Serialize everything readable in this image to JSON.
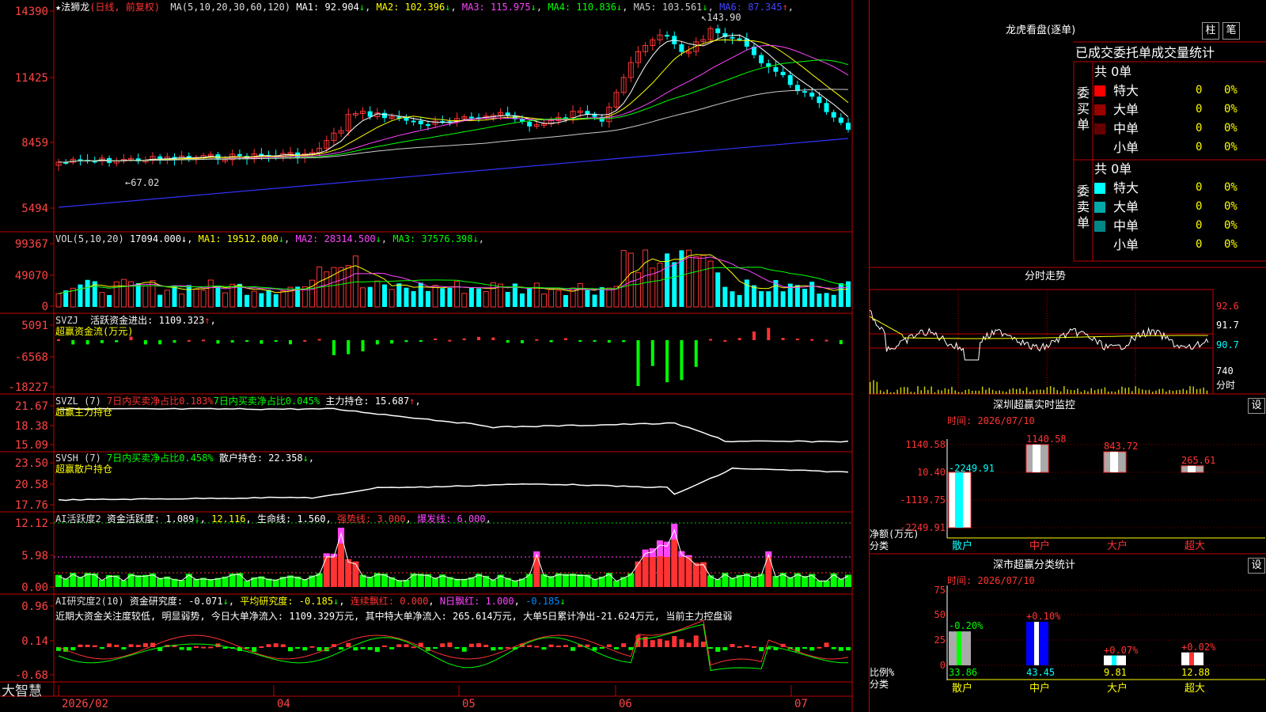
{
  "stock": {
    "name": "法狮龙",
    "mode": "(日线, 前复权)",
    "ma_header": "MA(5,10,20,30,60,120)",
    "ma": [
      {
        "label": "MA1: 92.904",
        "arrow": "↓",
        "color": "#ffffff"
      },
      {
        "label": "MA2: 102.396",
        "arrow": "↓",
        "color": "#ffff00"
      },
      {
        "label": "MA3: 115.975",
        "arrow": "↓",
        "color": "#ff44ff"
      },
      {
        "label": "MA4: 110.836",
        "arrow": "↓",
        "color": "#00ff00"
      },
      {
        "label": "MA5: 103.561",
        "arrow": "↓",
        "color": "#cccccc"
      },
      {
        "label": "MA6: 87.345",
        "arrow": "↑",
        "color": "#4444ff"
      }
    ],
    "high_label": "143.90",
    "low_label": "67.02",
    "y_ticks": [
      "14390",
      "11425",
      "8459",
      "5494"
    ]
  },
  "volume": {
    "header": "VOL(5,10,20)",
    "value": "17094.000",
    "ma": [
      {
        "label": "MA1: 19512.000",
        "arrow": "↓",
        "color": "#ffff00"
      },
      {
        "label": "MA2: 28314.500",
        "arrow": "↓",
        "color": "#ff44ff"
      },
      {
        "label": "MA3: 37576.398",
        "arrow": "↓",
        "color": "#00ff00"
      }
    ],
    "y_ticks": [
      "99367",
      "49070",
      "0"
    ]
  },
  "svzj": {
    "header": "SVZJ",
    "label": "活跃资金进出: 1109.323",
    "arrow": "↑",
    "sub": "超赢资金流(万元)",
    "y_ticks": [
      "5091",
      "-6568",
      "-18227"
    ]
  },
  "svzl": {
    "header": "SVZL (7)",
    "t1": "7日内买卖净占比0.183%",
    "t2": "7日内买卖净占比0.045%",
    "t3": "主力持仓: 15.687",
    "arrow": "↑",
    "sub": "超赢主力持仓",
    "y_ticks": [
      "21.67",
      "18.38",
      "15.09"
    ]
  },
  "svsh": {
    "header": "SVSH (7)",
    "t1": "7日内买卖净占比0.458%",
    "t2": "散户持仓: 22.358",
    "arrow": "↓",
    "sub": "超赢散户持仓",
    "y_ticks": [
      "23.50",
      "20.58",
      "17.76"
    ]
  },
  "ai_active": {
    "header": "AI活跃度2",
    "t1": "资金活跃度: 1.089",
    "t2": "12.116",
    "t3": "生命线: 1.560",
    "t4": "强势线: 3.000",
    "t5": "爆发线: 6.000",
    "y_ticks": [
      "12.12",
      "5.98",
      "0.00"
    ]
  },
  "ai_research": {
    "header": "AI研究度2(10)",
    "t1": "资金研究度: -0.071",
    "t2": "平均研究度: -0.185",
    "t3": "连续飘红: 0.000",
    "t4": "N日飘红: 1.000",
    "t5": "-0.185",
    "note": "近期大资金关注度较低, 明显弱势, 今日大单净流入: 1109.329万元, 其中特大单净流入: 265.614万元, 大单5日累计净出-21.624万元, 当前主力控盘弱",
    "y_ticks": [
      "0.96",
      "0.14",
      "-0.68"
    ]
  },
  "xaxis": {
    "brand": "大智慧",
    "labels": [
      "2026/02",
      "04",
      "05",
      "06",
      "07"
    ]
  },
  "right": {
    "title": "龙虎看盘(逐单)",
    "btn1": "柱",
    "btn2": "笔",
    "table_header": "已成交委托单成交量统计",
    "buy_label": "委买单",
    "sell_label": "委卖单",
    "buy_total": "共 0单",
    "sell_total": "共 0单",
    "buy_rows": [
      {
        "name": "特大",
        "count": "0",
        "pct": "0%",
        "color": "#ff0000"
      },
      {
        "name": "大单",
        "count": "0",
        "pct": "0%",
        "color": "#990000"
      },
      {
        "name": "中单",
        "count": "0",
        "pct": "0%",
        "color": "#660000"
      },
      {
        "name": "小单",
        "count": "0",
        "pct": "0%",
        "color": "#000000"
      }
    ],
    "sell_rows": [
      {
        "name": "特大",
        "count": "0",
        "pct": "0%",
        "color": "#00ffff"
      },
      {
        "name": "大单",
        "count": "0",
        "pct": "0%",
        "color": "#00aaaa"
      },
      {
        "name": "中单",
        "count": "0",
        "pct": "0%",
        "color": "#008888"
      },
      {
        "name": "小单",
        "count": "0",
        "pct": "0%",
        "color": "#000000"
      }
    ],
    "intraday_title": "分时走势",
    "intraday_ticks": [
      "92.6",
      "91.7",
      "90.7",
      "740",
      "分时"
    ],
    "monitor": {
      "title": "深圳超赢实时监控",
      "set": "设",
      "time": "时间: 2026/07/10",
      "y_ticks": [
        "1140.58",
        "10.40",
        "-1119.75",
        "-2249.91"
      ],
      "ylabel": "净额(万元)",
      "xlabel": "分类",
      "bars": [
        {
          "cat": "散户",
          "value": -2249.91,
          "label": "-2249.91",
          "cat_color": "#00ffff"
        },
        {
          "cat": "中户",
          "value": 1140.58,
          "label": "1140.58",
          "cat_color": "#ff3333"
        },
        {
          "cat": "大户",
          "value": 843.72,
          "label": "843.72",
          "cat_color": "#ff3333"
        },
        {
          "cat": "超大",
          "value": 265.61,
          "label": "265.61",
          "cat_color": "#ff3333"
        }
      ]
    },
    "stats": {
      "title": "深市超赢分类统计",
      "set": "设",
      "time": "时间: 2026/07/10",
      "y_ticks": [
        "75",
        "50",
        "25",
        "0"
      ],
      "ylabel": "比例%",
      "xlabel": "分类",
      "bars": [
        {
          "cat": "散户",
          "value": 33.86,
          "label": "33.86",
          "change": "-0.20%",
          "change_color": "#00ff00",
          "cat_color": "#ffff00"
        },
        {
          "cat": "中户",
          "value": 43.45,
          "label": "43.45",
          "change": "+0.10%",
          "change_color": "#ff3333",
          "cat_color": "#ffff00"
        },
        {
          "cat": "大户",
          "value": 9.81,
          "label": "9.81",
          "change": "+0.07%",
          "change_color": "#ff3333",
          "cat_color": "#ffff00"
        },
        {
          "cat": "超大",
          "value": 12.88,
          "label": "12.88",
          "change": "+0.02%",
          "change_color": "#ff3333",
          "cat_color": "#ffff00"
        }
      ]
    }
  },
  "colors": {
    "up": "#ff3333",
    "down": "#00ffff",
    "grid": "#c00000",
    "axis_text": "#ff4444"
  }
}
